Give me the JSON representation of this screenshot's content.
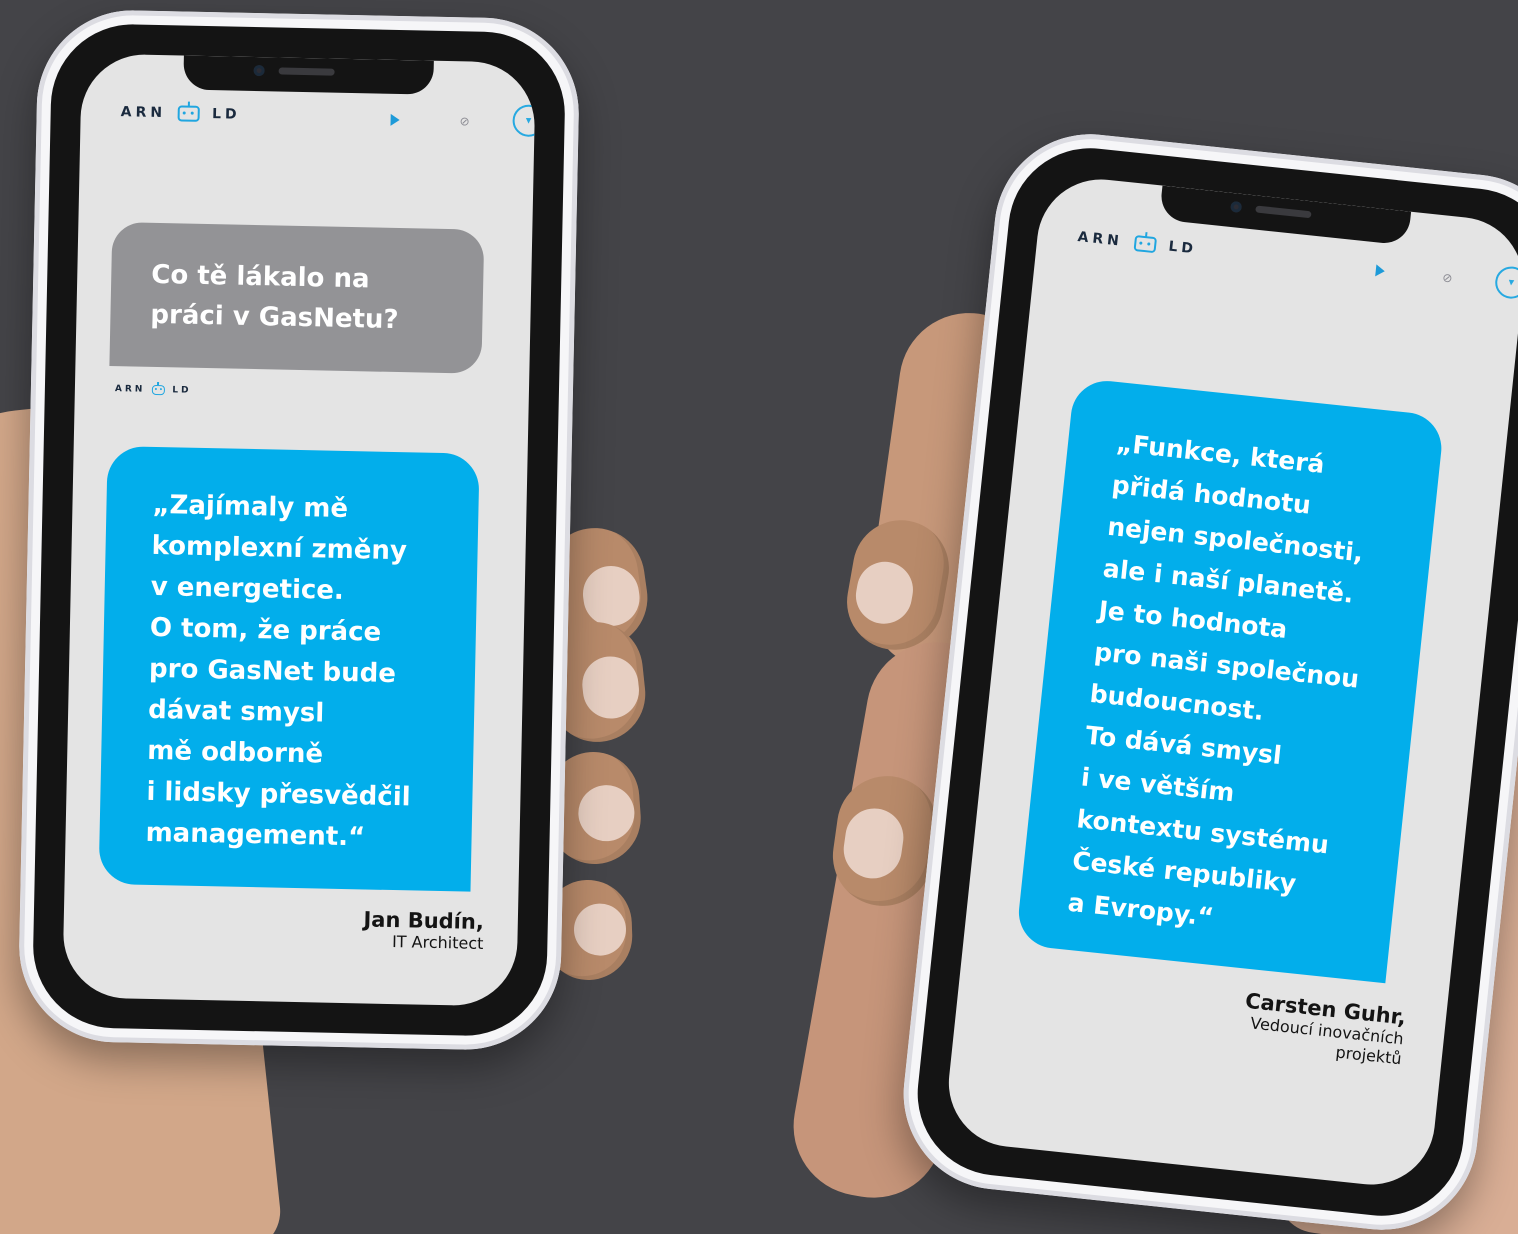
{
  "brand": {
    "logo_text_left": "ARN",
    "logo_text_right": "LD",
    "accent": "#02aeeb",
    "question_bg": "#939396",
    "background": "#444448"
  },
  "phone_left": {
    "header": {
      "icons": [
        "play-icon",
        "mute-icon",
        "menu-chevron-icon"
      ]
    },
    "question_lines": [
      "Co tě lákalo na",
      "práci v GasNetu?"
    ],
    "answer_lines": [
      "„Zajímaly mě",
      "komplexní změny",
      "v energetice.",
      "O tom, že práce",
      "pro GasNet bude",
      "dávat smysl",
      "mě odborně",
      "i lidsky přesvědčil",
      "management.“"
    ],
    "author": {
      "name": "Jan Budín,",
      "role": "IT Architect"
    }
  },
  "phone_right": {
    "header": {
      "icons": [
        "play-icon",
        "mute-icon",
        "menu-chevron-icon"
      ]
    },
    "answer_lines": [
      "„Funkce, která",
      "přidá hodnotu",
      "nejen společnosti,",
      "ale i naší planetě.",
      "Je to hodnota",
      "pro naši společnou",
      "budoucnost.",
      "To dává smysl",
      "i ve větším",
      "kontextu systému",
      "České republiky",
      "a Evropy.“"
    ],
    "author": {
      "name": "Carsten Guhr,",
      "role_lines": [
        "Vedoucí inovačních",
        "projektů"
      ]
    }
  }
}
